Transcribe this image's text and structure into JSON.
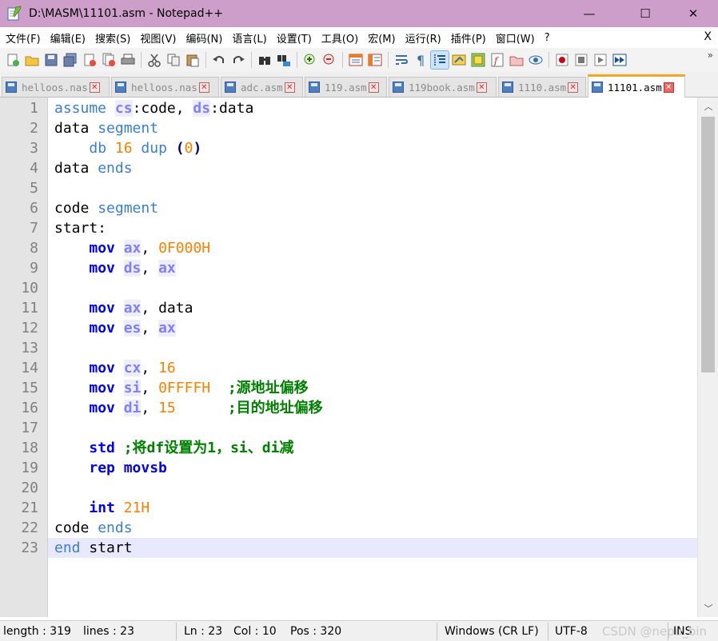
{
  "window": {
    "title": "D:\\MASM\\11101.asm - Notepad++",
    "controls": {
      "minimize": "—",
      "maximize": "☐",
      "close": "✕"
    }
  },
  "menubar": {
    "items": [
      "文件(F)",
      "编辑(E)",
      "搜索(S)",
      "视图(V)",
      "编码(N)",
      "语言(L)",
      "设置(T)",
      "工具(O)",
      "宏(M)",
      "运行(R)",
      "插件(P)",
      "窗口(W)",
      "?"
    ],
    "close_label": "X"
  },
  "toolbar": {
    "overflow_label": "»",
    "icons": [
      "new-file-icon",
      "open-file-icon",
      "save-icon",
      "save-all-icon",
      "close-icon",
      "close-all-icon",
      "print-icon",
      "cut-icon",
      "copy-icon",
      "paste-icon",
      "undo-icon",
      "redo-icon",
      "find-icon",
      "replace-icon",
      "zoom-in-icon",
      "zoom-out-icon",
      "sync-vertical-icon",
      "sync-horizontal-icon",
      "word-wrap-icon",
      "show-all-chars-icon",
      "indent-guide-icon",
      "udl-icon",
      "doc-map-icon",
      "function-list-icon",
      "folder-workspace-icon",
      "monitoring-icon",
      "record-macro-icon",
      "stop-record-icon",
      "play-macro-icon",
      "run-macro-multiple-icon"
    ]
  },
  "tabs": [
    {
      "label": "helloos.nas",
      "active": false
    },
    {
      "label": "helloos.nas",
      "active": false
    },
    {
      "label": "adc.asm",
      "active": false
    },
    {
      "label": "119.asm",
      "active": false
    },
    {
      "label": "119book.asm",
      "active": false
    },
    {
      "label": "1110.asm",
      "active": false
    },
    {
      "label": "11101.asm",
      "active": true
    }
  ],
  "editor": {
    "current_line": 23,
    "lines": [
      {
        "n": "1",
        "tokens": [
          {
            "t": "assume",
            "c": "kw-light"
          },
          {
            "t": " ",
            "c": "plain"
          },
          {
            "t": "cs",
            "c": "reg"
          },
          {
            "t": ":code, ",
            "c": "plain"
          },
          {
            "t": "ds",
            "c": "reg"
          },
          {
            "t": ":data",
            "c": "plain"
          }
        ]
      },
      {
        "n": "2",
        "tokens": [
          {
            "t": "data ",
            "c": "plain"
          },
          {
            "t": "segment",
            "c": "kw-light"
          }
        ]
      },
      {
        "n": "3",
        "tokens": [
          {
            "t": "    ",
            "c": "plain"
          },
          {
            "t": "db",
            "c": "kw-light"
          },
          {
            "t": " ",
            "c": "plain"
          },
          {
            "t": "16",
            "c": "num"
          },
          {
            "t": " ",
            "c": "plain"
          },
          {
            "t": "dup",
            "c": "kw-light"
          },
          {
            "t": " ",
            "c": "plain"
          },
          {
            "t": "(",
            "c": "paren"
          },
          {
            "t": "0",
            "c": "num"
          },
          {
            "t": ")",
            "c": "paren"
          }
        ]
      },
      {
        "n": "4",
        "tokens": [
          {
            "t": "data ",
            "c": "plain"
          },
          {
            "t": "ends",
            "c": "kw-light"
          }
        ]
      },
      {
        "n": "5",
        "tokens": []
      },
      {
        "n": "6",
        "tokens": [
          {
            "t": "code ",
            "c": "plain"
          },
          {
            "t": "segment",
            "c": "kw-light"
          }
        ]
      },
      {
        "n": "7",
        "tokens": [
          {
            "t": "start:",
            "c": "plain"
          }
        ]
      },
      {
        "n": "8",
        "tokens": [
          {
            "t": "    ",
            "c": "plain"
          },
          {
            "t": "mov",
            "c": "kw-blue"
          },
          {
            "t": " ",
            "c": "plain"
          },
          {
            "t": "ax",
            "c": "reg"
          },
          {
            "t": ", ",
            "c": "plain"
          },
          {
            "t": "0F000H",
            "c": "num"
          }
        ]
      },
      {
        "n": "9",
        "tokens": [
          {
            "t": "    ",
            "c": "plain"
          },
          {
            "t": "mov",
            "c": "kw-blue"
          },
          {
            "t": " ",
            "c": "plain"
          },
          {
            "t": "ds",
            "c": "reg"
          },
          {
            "t": ", ",
            "c": "plain"
          },
          {
            "t": "ax",
            "c": "reg"
          }
        ]
      },
      {
        "n": "10",
        "tokens": []
      },
      {
        "n": "11",
        "tokens": [
          {
            "t": "    ",
            "c": "plain"
          },
          {
            "t": "mov",
            "c": "kw-blue"
          },
          {
            "t": " ",
            "c": "plain"
          },
          {
            "t": "ax",
            "c": "reg"
          },
          {
            "t": ", data",
            "c": "plain"
          }
        ]
      },
      {
        "n": "12",
        "tokens": [
          {
            "t": "    ",
            "c": "plain"
          },
          {
            "t": "mov",
            "c": "kw-blue"
          },
          {
            "t": " ",
            "c": "plain"
          },
          {
            "t": "es",
            "c": "reg"
          },
          {
            "t": ", ",
            "c": "plain"
          },
          {
            "t": "ax",
            "c": "reg"
          }
        ]
      },
      {
        "n": "13",
        "tokens": []
      },
      {
        "n": "14",
        "tokens": [
          {
            "t": "    ",
            "c": "plain"
          },
          {
            "t": "mov",
            "c": "kw-blue"
          },
          {
            "t": " ",
            "c": "plain"
          },
          {
            "t": "cx",
            "c": "reg"
          },
          {
            "t": ", ",
            "c": "plain"
          },
          {
            "t": "16",
            "c": "num"
          }
        ]
      },
      {
        "n": "15",
        "tokens": [
          {
            "t": "    ",
            "c": "plain"
          },
          {
            "t": "mov",
            "c": "kw-blue"
          },
          {
            "t": " ",
            "c": "plain"
          },
          {
            "t": "si",
            "c": "reg"
          },
          {
            "t": ", ",
            "c": "plain"
          },
          {
            "t": "0FFFFH",
            "c": "num"
          },
          {
            "t": "  ",
            "c": "plain"
          },
          {
            "t": ";源地址偏移",
            "c": "cmt"
          }
        ]
      },
      {
        "n": "16",
        "tokens": [
          {
            "t": "    ",
            "c": "plain"
          },
          {
            "t": "mov",
            "c": "kw-blue"
          },
          {
            "t": " ",
            "c": "plain"
          },
          {
            "t": "di",
            "c": "reg"
          },
          {
            "t": ", ",
            "c": "plain"
          },
          {
            "t": "15",
            "c": "num"
          },
          {
            "t": "      ",
            "c": "plain"
          },
          {
            "t": ";目的地址偏移",
            "c": "cmt"
          }
        ]
      },
      {
        "n": "17",
        "tokens": []
      },
      {
        "n": "18",
        "tokens": [
          {
            "t": "    ",
            "c": "plain"
          },
          {
            "t": "std",
            "c": "kw-blue"
          },
          {
            "t": " ",
            "c": "plain"
          },
          {
            "t": ";将df设置为1，si、di减",
            "c": "cmt"
          }
        ]
      },
      {
        "n": "19",
        "tokens": [
          {
            "t": "    ",
            "c": "plain"
          },
          {
            "t": "rep movsb",
            "c": "kw-blue"
          }
        ]
      },
      {
        "n": "20",
        "tokens": []
      },
      {
        "n": "21",
        "tokens": [
          {
            "t": "    ",
            "c": "plain"
          },
          {
            "t": "int",
            "c": "kw-blue"
          },
          {
            "t": " ",
            "c": "plain"
          },
          {
            "t": "21H",
            "c": "num"
          }
        ]
      },
      {
        "n": "22",
        "tokens": [
          {
            "t": "code ",
            "c": "plain"
          },
          {
            "t": "ends",
            "c": "kw-light"
          }
        ]
      },
      {
        "n": "23",
        "tokens": [
          {
            "t": "end",
            "c": "kw-light"
          },
          {
            "t": " start",
            "c": "plain"
          }
        ]
      }
    ]
  },
  "scrollbar": {
    "up_arrow": "︿",
    "down_arrow": "﹀"
  },
  "statusbar": {
    "length": "length : 319",
    "lines": "lines : 23",
    "ln": "Ln : 23",
    "col": "Col : 10",
    "pos": "Pos : 320",
    "eol": "Windows (CR LF)",
    "encoding": "UTF-8",
    "mode": "INS",
    "watermark": "CSDN @nepu_bin"
  },
  "colors": {
    "titlebar": "#ce9ecb",
    "keyword_instruction": "#0000ff",
    "keyword_directive": "#3a7fd0",
    "register": "#8080ff",
    "number": "#ff8000",
    "comment": "#008000",
    "current_line": "#e8e8ff",
    "active_tab_accent": "#f5a623"
  }
}
